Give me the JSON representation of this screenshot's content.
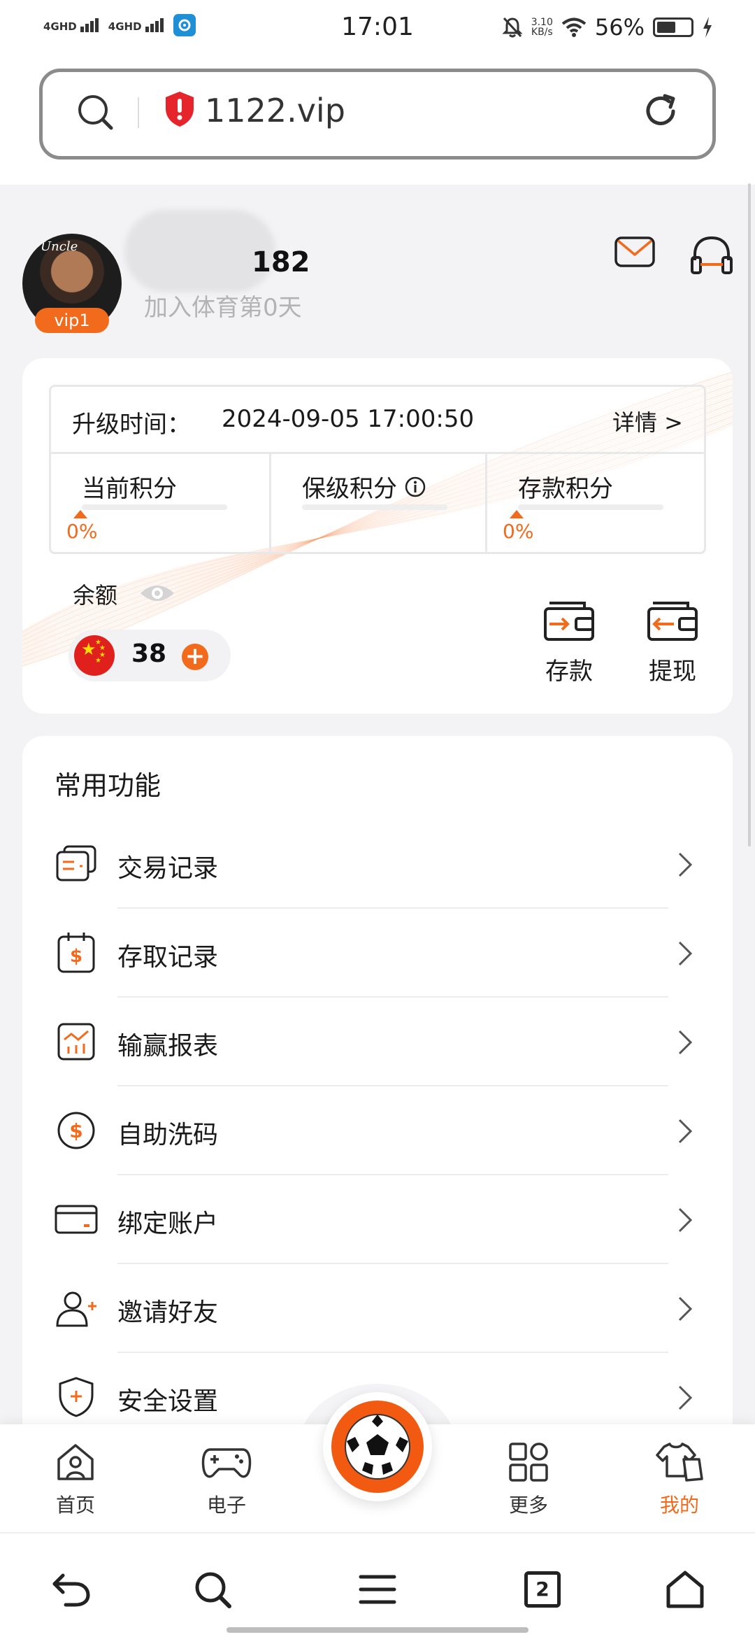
{
  "status_bar": {
    "time": "17:01",
    "net1": "4GHD",
    "net2": "4GHD",
    "speed_value": "3.10",
    "speed_unit": "KB/s",
    "battery": "56%",
    "battery_level": 0.56
  },
  "browser": {
    "url": "1122.vip",
    "tabs_count": "2"
  },
  "profile": {
    "vip_level": "vip1",
    "username_suffix": "182",
    "join_text": "加入体育第0天"
  },
  "vip_card": {
    "upgrade_label": "升级时间：",
    "upgrade_time": "2024-09-05 17:00:50",
    "detail_link": "详情 >",
    "points": [
      {
        "title": "当前积分",
        "percent": "0%"
      },
      {
        "title": "保级积分"
      },
      {
        "title": "存款积分",
        "percent": "0%"
      }
    ],
    "balance_label": "余额",
    "balance_amount": "38",
    "deposit_label": "存款",
    "withdraw_label": "提现"
  },
  "functions": {
    "title": "常用功能",
    "items": [
      {
        "label": "交易记录",
        "icon": "transaction-icon"
      },
      {
        "label": "存取记录",
        "icon": "deposit-record-icon"
      },
      {
        "label": "输赢报表",
        "icon": "report-icon"
      },
      {
        "label": "自助洗码",
        "icon": "rebate-icon"
      },
      {
        "label": "绑定账户",
        "icon": "card-icon"
      },
      {
        "label": "邀请好友",
        "icon": "invite-icon"
      },
      {
        "label": "安全设置",
        "icon": "shield-icon"
      }
    ]
  },
  "app_nav": {
    "items": [
      {
        "label": "首页"
      },
      {
        "label": "电子"
      },
      {
        "label": "更多"
      },
      {
        "label": "我的"
      }
    ]
  },
  "colors": {
    "accent": "#f26a1b",
    "background": "#f3f3f5"
  }
}
